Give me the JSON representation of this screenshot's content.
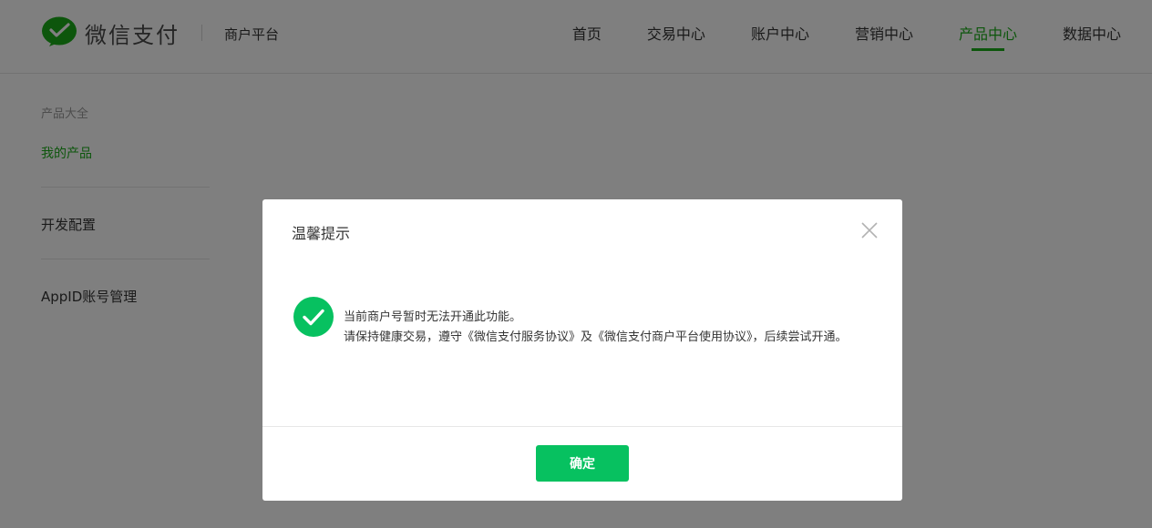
{
  "header": {
    "brand": "微信支付",
    "platform": "商户平台",
    "nav": [
      {
        "label": "首页",
        "active": false
      },
      {
        "label": "交易中心",
        "active": false
      },
      {
        "label": "账户中心",
        "active": false
      },
      {
        "label": "营销中心",
        "active": false
      },
      {
        "label": "产品中心",
        "active": true
      },
      {
        "label": "数据中心",
        "active": false
      }
    ]
  },
  "sidebar": {
    "group_title": "产品大全",
    "active_item": "我的产品",
    "items": [
      "开发配置",
      "AppID账号管理"
    ]
  },
  "dialog": {
    "title": "温馨提示",
    "message_line1": "当前商户号暂时无法开通此功能。",
    "message_line2": "请保持健康交易，遵守《微信支付服务协议》及《微信支付商户平台使用协议》，后续尝试开通。",
    "confirm_label": "确定"
  },
  "colors": {
    "brand_green": "#1aad19",
    "button_green": "#07c160",
    "overlay": "rgba(0,0,0,0.5)"
  },
  "icons": {
    "logo": "wechat-pay-logo-icon",
    "close": "close-icon",
    "success": "check-circle-icon"
  }
}
